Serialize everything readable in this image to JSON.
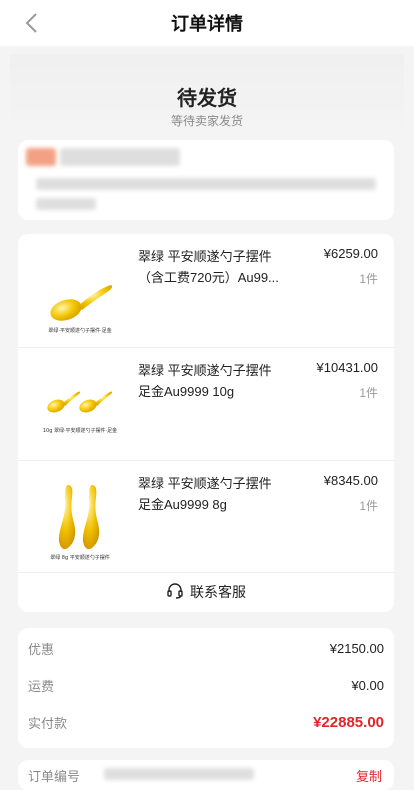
{
  "header": {
    "title": "订单详情",
    "back_icon": "chevron-left-icon"
  },
  "status": {
    "title": "待发货",
    "subtitle": "等待卖家发货"
  },
  "items": [
    {
      "name": "翠绿 平安顺遂勺子摆件（含工费720元）Au99...",
      "price": "¥6259.00",
      "qty": "1件",
      "thumb_caption": "翠绿·平安顺遂勺子摆件·足金"
    },
    {
      "name": "翠绿 平安顺遂勺子摆件 足金Au9999 10g",
      "price": "¥10431.00",
      "qty": "1件",
      "thumb_caption": "10g 翠绿·平安顺遂勺子摆件·足金"
    },
    {
      "name": "翠绿 平安顺遂勺子摆件 足金Au9999 8g",
      "price": "¥8345.00",
      "qty": "1件",
      "thumb_caption": "翠绿 8g 平安顺遂勺子摆件"
    }
  ],
  "service": {
    "label": "联系客服",
    "icon": "headset-icon"
  },
  "summary": {
    "discount_label": "优惠",
    "discount_value": "¥2150.00",
    "shipping_label": "运费",
    "shipping_value": "¥0.00",
    "paid_label": "实付款",
    "paid_value": "¥22885.00"
  },
  "order": {
    "number_label": "订单编号",
    "copy_label": "复制"
  },
  "colors": {
    "accent_red": "#e0262b",
    "gold": "#f2c200",
    "background": "#f4f4f4"
  }
}
